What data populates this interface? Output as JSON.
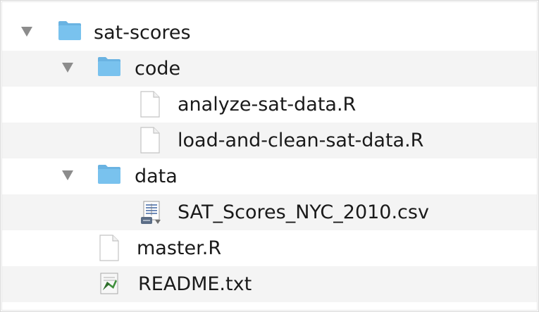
{
  "tree": {
    "items": [
      {
        "label": "sat-scores",
        "kind": "folder",
        "icon": "folder-icon",
        "expanded": true,
        "level": 0
      },
      {
        "label": "code",
        "kind": "folder",
        "icon": "folder-icon",
        "expanded": true,
        "level": 1
      },
      {
        "label": "analyze-sat-data.R",
        "kind": "file",
        "icon": "document-icon",
        "level": 2
      },
      {
        "label": "load-and-clean-sat-data.R",
        "kind": "file",
        "icon": "document-icon",
        "level": 2
      },
      {
        "label": "data",
        "kind": "folder",
        "icon": "folder-icon",
        "expanded": true,
        "level": 1
      },
      {
        "label": "SAT_Scores_NYC_2010.csv",
        "kind": "file",
        "icon": "csv-file-icon",
        "level": 2
      },
      {
        "label": "master.R",
        "kind": "file",
        "icon": "document-icon",
        "level": 1
      },
      {
        "label": "README.txt",
        "kind": "file",
        "icon": "text-file-icon",
        "level": 1
      }
    ]
  },
  "colors": {
    "folder_blue": "#79c2ee",
    "folder_tab": "#6ab3e2",
    "disclosure": "#8c8c8c",
    "stripe": "#f4f4f4"
  }
}
